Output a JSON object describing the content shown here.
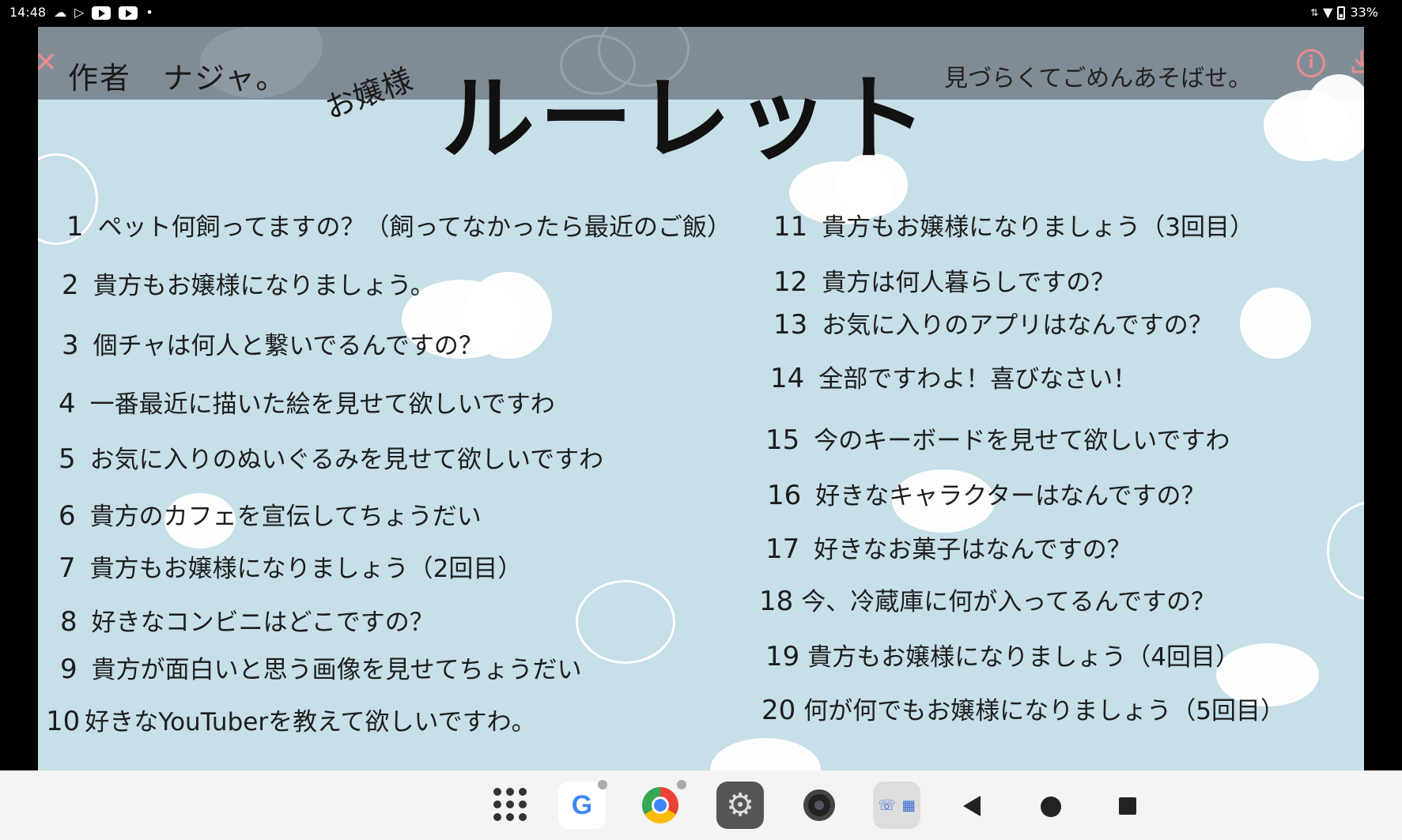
{
  "status_bar": {
    "time": "14:48",
    "battery": "33%",
    "icons": [
      "cloud-icon",
      "play-store-icon",
      "youtube-icon",
      "youtube-icon",
      "dot-icon",
      "data-arrows-icon",
      "wifi-icon",
      "battery-icon"
    ]
  },
  "viewer": {
    "close_glyph": "✕",
    "info_glyph": "i",
    "author": "作者　ナジャ。",
    "subtitle": "お嬢様",
    "title": "ルーレット",
    "apology": "見づらくてごめんあそばせ。"
  },
  "rules_left": [
    {
      "num": "1",
      "text": "ペット何飼ってますの？（飼ってなかったら最近のご飯）"
    },
    {
      "num": "2",
      "text": "貴方もお嬢様になりましょう。"
    },
    {
      "num": "3",
      "text": "個チャは何人と繋いでるんですの？"
    },
    {
      "num": "4",
      "text": "一番最近に描いた絵を見せて欲しいですわ"
    },
    {
      "num": "5",
      "text": "お気に入りのぬいぐるみを見せて欲しいですわ"
    },
    {
      "num": "6",
      "text": "貴方のカフェを宣伝してちょうだい"
    },
    {
      "num": "7",
      "text": "貴方もお嬢様になりましょう（2回目）"
    },
    {
      "num": "8",
      "text": "好きなコンビニはどこですの？"
    },
    {
      "num": "9",
      "text": "貴方が面白いと思う画像を見せてちょうだい"
    },
    {
      "num": "10",
      "text": "好きなYouTuberを教えて欲しいですわ。"
    }
  ],
  "rules_right": [
    {
      "num": "11",
      "text": "貴方もお嬢様になりましょう（3回目）"
    },
    {
      "num": "12",
      "text": "貴方は何人暮らしですの？"
    },
    {
      "num": "13",
      "text": "お気に入りのアプリはなんですの？"
    },
    {
      "num": "14",
      "text": "全部ですわよ！喜びなさい！"
    },
    {
      "num": "15",
      "text": "今のキーボードを見せて欲しいですわ"
    },
    {
      "num": "16",
      "text": "好きなキャラクターはなんですの？"
    },
    {
      "num": "17",
      "text": "好きなお菓子はなんですの？"
    },
    {
      "num": "18",
      "text": "今、冷蔵庫に何が入ってるんですの？"
    },
    {
      "num": "19",
      "text": "貴方もお嬢様になりましょう（4回目）"
    },
    {
      "num": "20",
      "text": "何が何でもお嬢様になりましょう（5回目）"
    }
  ],
  "nav_bar": {
    "google_glyph": "G",
    "settings_glyph": "⚙",
    "apps": [
      "apps-grid-icon",
      "google-icon",
      "chrome-icon",
      "settings-icon",
      "camera-icon",
      "multi-app-icon"
    ],
    "controls": [
      "back-icon",
      "home-icon",
      "recents-icon"
    ]
  },
  "colors": {
    "accent_pink": "#e98b8f",
    "sky_blue": "#c6dfe9",
    "title_band": "#7f8c95"
  }
}
